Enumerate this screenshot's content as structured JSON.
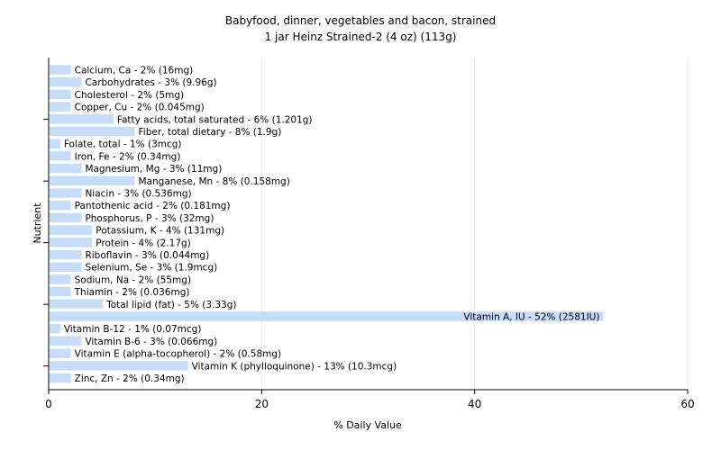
{
  "chart_data": {
    "type": "bar",
    "orientation": "horizontal",
    "title": "Babyfood, dinner, vegetables and bacon, strained",
    "subtitle": "1 jar Heinz Strained-2 (4 oz) (113g)",
    "xlabel": "% Daily Value",
    "ylabel": "Nutrient",
    "xlim": [
      0,
      60
    ],
    "xticks": [
      "0",
      "20",
      "40",
      "60"
    ],
    "grid": true,
    "bar_color": "#c6dcf8",
    "categories": [
      "Calcium, Ca - 2% (16mg)",
      "Carbohydrates - 3% (9.96g)",
      "Cholesterol - 2% (5mg)",
      "Copper, Cu - 2% (0.045mg)",
      "Fatty acids, total saturated - 6% (1.201g)",
      "Fiber, total dietary - 8% (1.9g)",
      "Folate, total - 1% (3mcg)",
      "Iron, Fe - 2% (0.34mg)",
      "Magnesium, Mg - 3% (11mg)",
      "Manganese, Mn - 8% (0.158mg)",
      "Niacin - 3% (0.536mg)",
      "Pantothenic acid - 2% (0.181mg)",
      "Phosphorus, P - 3% (32mg)",
      "Potassium, K - 4% (131mg)",
      "Protein - 4% (2.17g)",
      "Riboflavin - 3% (0.044mg)",
      "Selenium, Se - 3% (1.9mcg)",
      "Sodium, Na - 2% (55mg)",
      "Thiamin - 2% (0.036mg)",
      "Total lipid (fat) - 5% (3.33g)",
      "Vitamin A, IU - 52% (2581IU)",
      "Vitamin B-12 - 1% (0.07mcg)",
      "Vitamin B-6 - 3% (0.066mg)",
      "Vitamin E (alpha-tocopherol) - 2% (0.58mg)",
      "Vitamin K (phylloquinone) - 13% (10.3mcg)",
      "Zinc, Zn - 2% (0.34mg)"
    ],
    "values": [
      2,
      3,
      2,
      2,
      6,
      8,
      1,
      2,
      3,
      8,
      3,
      2,
      3,
      4,
      4,
      3,
      3,
      2,
      2,
      5,
      52,
      1,
      3,
      2,
      13,
      2
    ]
  }
}
